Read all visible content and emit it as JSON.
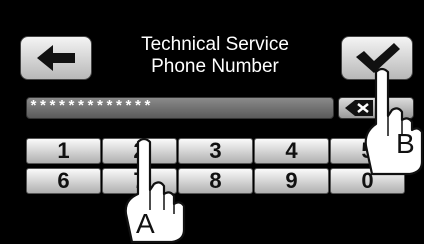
{
  "header": {
    "title_line1": "Technical Service",
    "title_line2": "Phone Number",
    "back_icon": "arrow-left-icon",
    "confirm_icon": "checkmark-icon"
  },
  "password": {
    "value": "*************",
    "backspace_icon": "backspace-icon"
  },
  "keypad": {
    "row1": [
      "1",
      "2",
      "3",
      "4",
      "5"
    ],
    "row2": [
      "6",
      "7",
      "8",
      "9",
      "0"
    ]
  },
  "callouts": {
    "a": "A",
    "b": "B"
  }
}
